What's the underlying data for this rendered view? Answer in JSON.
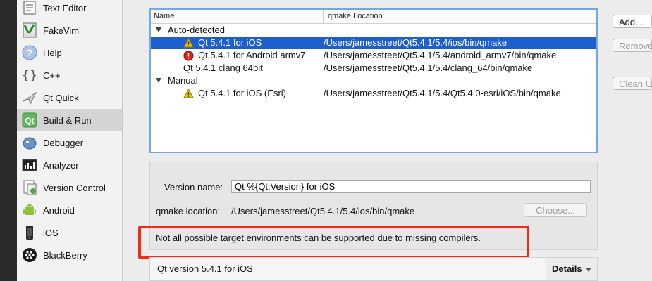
{
  "sidebar": {
    "items": [
      {
        "label": "Text Editor",
        "icon": "text-editor-icon"
      },
      {
        "label": "FakeVim",
        "icon": "fakevim-icon"
      },
      {
        "label": "Help",
        "icon": "help-icon"
      },
      {
        "label": "C++",
        "icon": "cpp-braces-icon"
      },
      {
        "label": "Qt Quick",
        "icon": "qt-quick-icon"
      },
      {
        "label": "Build & Run",
        "icon": "build-run-icon",
        "selected": true
      },
      {
        "label": "Debugger",
        "icon": "debugger-icon"
      },
      {
        "label": "Analyzer",
        "icon": "analyzer-icon"
      },
      {
        "label": "Version Control",
        "icon": "version-control-icon"
      },
      {
        "label": "Android",
        "icon": "android-icon"
      },
      {
        "label": "iOS",
        "icon": "ios-device-icon"
      },
      {
        "label": "BlackBerry",
        "icon": "blackberry-icon"
      }
    ]
  },
  "tree": {
    "headers": {
      "name": "Name",
      "location": "qmake Location"
    },
    "groups": [
      {
        "label": "Auto-detected",
        "rows": [
          {
            "name": "Qt 5.4.1 for iOS",
            "location": "/Users/jamesstreet/Qt5.4.1/5.4/ios/bin/qmake",
            "status": "warning",
            "selected": true
          },
          {
            "name": "Qt 5.4.1 for Android armv7",
            "location": "/Users/jamesstreet/Qt5.4.1/5.4/android_armv7/bin/qmake",
            "status": "error"
          },
          {
            "name": "Qt 5.4.1 clang 64bit",
            "location": "/Users/jamesstreet/Qt5.4.1/5.4/clang_64/bin/qmake",
            "status": "none"
          }
        ]
      },
      {
        "label": "Manual",
        "rows": [
          {
            "name": "Qt 5.4.1 for iOS (Esri)",
            "location": "/Users/jamesstreet/Qt5.4.1/5.4/Qt5.4.0-esri/iOS/bin/qmake",
            "status": "warning"
          }
        ]
      }
    ]
  },
  "buttons": {
    "add": "Add...",
    "remove": "Remove",
    "clean_up": "Clean Up"
  },
  "details_panel": {
    "version_name_label": "Version name:",
    "version_name_value": "Qt %{Qt:Version} for iOS",
    "qmake_location_label": "qmake location:",
    "qmake_location_value": "/Users/jamesstreet/Qt5.4.1/5.4/ios/bin/qmake",
    "choose_label": "Choose...",
    "warning_message": "Not all possible target environments can be supported due to missing compilers."
  },
  "details_bar": {
    "summary": "Qt version 5.4.1 for iOS",
    "details_label": "Details"
  },
  "colors": {
    "selection": "#1d5fcf",
    "highlight_box": "#f22b16",
    "warning": "#f5c400",
    "error": "#d9261c"
  }
}
